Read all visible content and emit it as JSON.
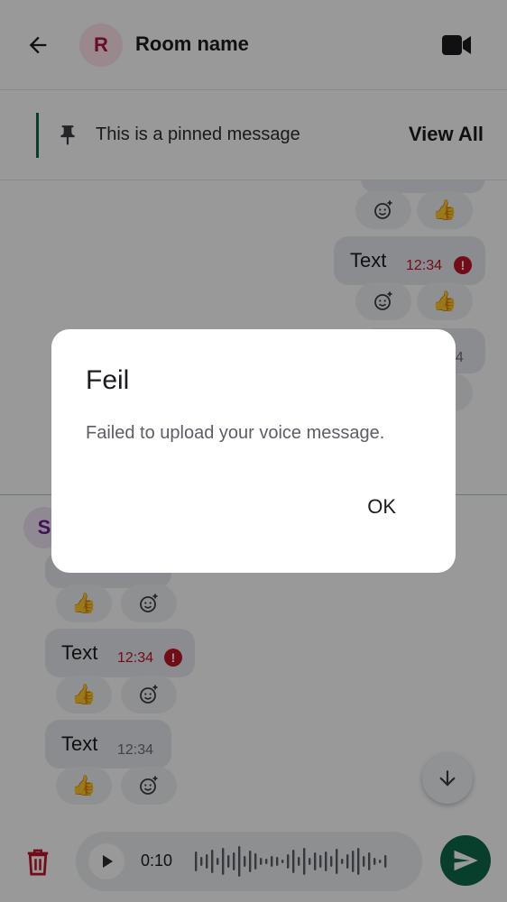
{
  "header": {
    "room_initial": "R",
    "room_name": "Room name",
    "back_icon": "arrow-back-icon",
    "video_icon": "video-call-icon"
  },
  "pinned": {
    "text": "This is a pinned message",
    "view_all": "View All",
    "accent_color": "#0d6a4a"
  },
  "messages": {
    "outgoing_1": {
      "text": "Text",
      "time": "12:34",
      "failed": true
    },
    "outgoing_2_time_partial": "34",
    "sender_initial": "S",
    "incoming_1": {
      "text": "Text",
      "time": "12:34",
      "failed": true
    },
    "incoming_2": {
      "text": "Text",
      "time": "12:34",
      "failed": false
    },
    "reaction_emoji": "👍"
  },
  "composer": {
    "duration": "0:10",
    "delete_icon": "trash-icon",
    "send_icon": "send-icon",
    "play_icon": "play-icon"
  },
  "dialog": {
    "title": "Feil",
    "message": "Failed to upload your voice message.",
    "ok_label": "OK"
  },
  "colors": {
    "error": "#c0142a",
    "accent": "#0d6a4a",
    "scrim": "rgba(0,0,0,0.40)"
  }
}
